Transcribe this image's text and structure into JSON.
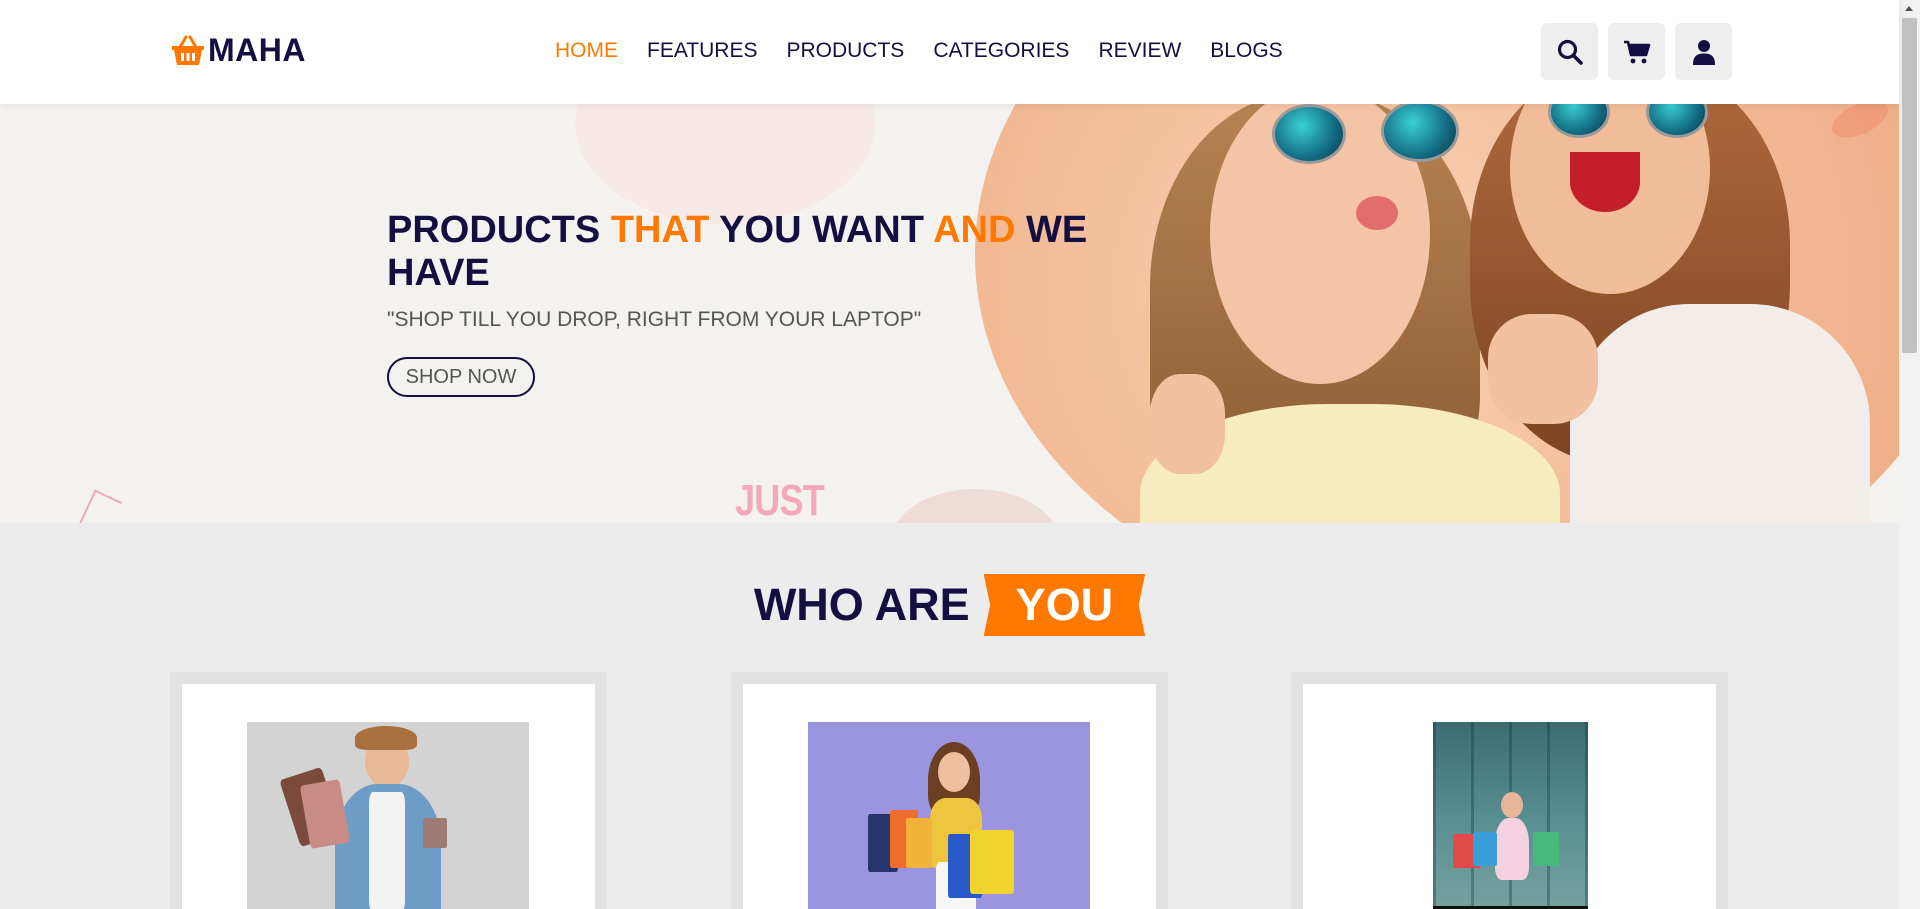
{
  "brand": {
    "name": "MAHA",
    "icon": "basket-icon"
  },
  "nav": {
    "items": [
      {
        "label": "HOME",
        "active": true
      },
      {
        "label": "FEATURES",
        "active": false
      },
      {
        "label": "PRODUCTS",
        "active": false
      },
      {
        "label": "CATEGORIES",
        "active": false
      },
      {
        "label": "REVIEW",
        "active": false
      },
      {
        "label": "BLOGS",
        "active": false
      }
    ]
  },
  "header_icons": [
    "search-icon",
    "cart-icon",
    "user-icon"
  ],
  "hero": {
    "title_parts": [
      "PRODUCTS ",
      "THAT",
      " YOU WANT ",
      "AND",
      " WE HAVE"
    ],
    "subtitle": "\"SHOP TILL YOU DROP, RIGHT FROM YOUR LAPTOP\"",
    "button": "SHOP NOW",
    "decor_text": "JUST"
  },
  "who": {
    "title": "WHO ARE",
    "badge": "YOU"
  },
  "colors": {
    "accent": "#ff7800",
    "dark": "#130f40",
    "hero_bg": "#f4f2ee",
    "section_bg": "#ececec"
  }
}
